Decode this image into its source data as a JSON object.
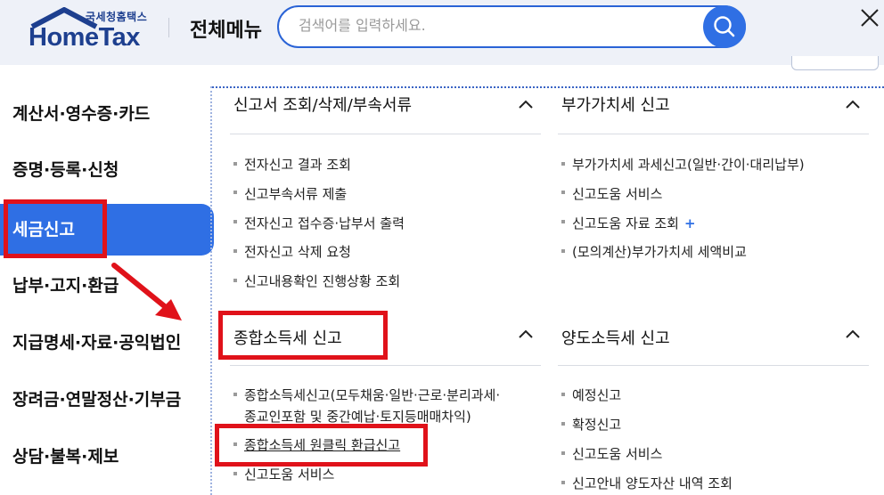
{
  "header": {
    "logo_small": "국세청홈택스",
    "logo_main": "HomeTax",
    "menu_title": "전체메뉴",
    "search_placeholder": "검색어를 입력하세요."
  },
  "nav": {
    "items": [
      {
        "label": "계산서·영수증·카드"
      },
      {
        "label": "증명·등록·신청"
      },
      {
        "label": "세금신고"
      },
      {
        "label": "납부·고지·환급"
      },
      {
        "label": "지급명세·자료·공익법인"
      },
      {
        "label": "장려금·연말정산·기부금"
      },
      {
        "label": "상담·불복·제보"
      }
    ],
    "active_index": 2
  },
  "sections": [
    {
      "title": "신고서 조회/삭제/부속서류",
      "items": [
        "전자신고 결과 조회",
        "신고부속서류 제출",
        "전자신고 접수증·납부서 출력",
        "전자신고 삭제 요청",
        "신고내용확인 진행상황 조회"
      ]
    },
    {
      "title": "부가가치세 신고",
      "items": [
        "부가가치세 과세신고(일반·간이·대리납부)",
        "신고도움 서비스",
        "신고도움 자료 조회",
        "(모의계산)부가가치세 세액비교"
      ],
      "plus": "+"
    },
    {
      "title": "종합소득세 신고",
      "items": [
        "종합소득세신고(모두채움·일반·근로·분리과세·",
        "종교인포함 및 중간예납·토지등매매차익)",
        "종합소득세 원클릭 환급신고",
        "신고도움 서비스"
      ]
    },
    {
      "title": "양도소득세 신고",
      "items": [
        "예정신고",
        "확정신고",
        "신고도움 서비스",
        "신고안내 양도자산 내역 조회"
      ]
    }
  ],
  "colors": {
    "accent": "#2f6fe4",
    "highlight": "#e0121a",
    "header_bg": "#eef1f8"
  }
}
